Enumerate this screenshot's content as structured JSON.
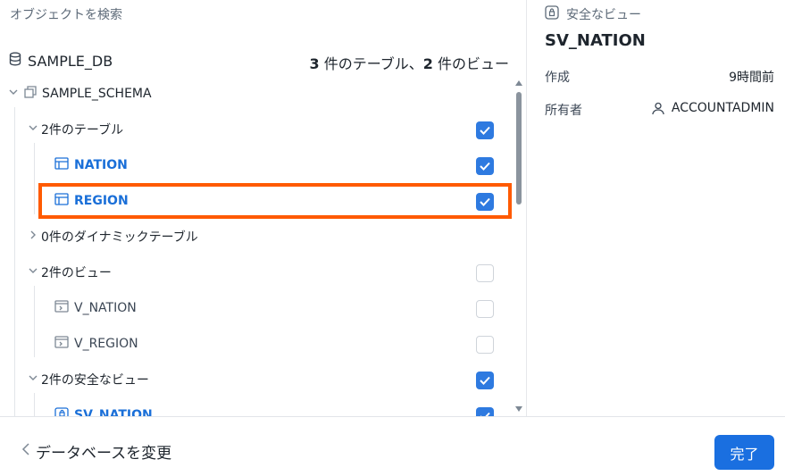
{
  "search": {
    "label": "オブジェクトを検索"
  },
  "database": {
    "name": "SAMPLE_DB",
    "table_count": "3",
    "view_count": "2",
    "summary_mid": " 件のテーブル、",
    "summary_end": " 件のビュー"
  },
  "schema": {
    "name": "SAMPLE_SCHEMA"
  },
  "groups": {
    "tables": {
      "label": "2件のテーブル"
    },
    "dynamic_tables": {
      "label": "0件のダイナミックテーブル"
    },
    "views": {
      "label": "2件のビュー"
    },
    "secure_views": {
      "label": "2件の安全なビュー"
    }
  },
  "items": {
    "nation": {
      "label": "NATION",
      "checked": true
    },
    "region": {
      "label": "REGION",
      "checked": true
    },
    "v_nation": {
      "label": "V_NATION",
      "checked": false
    },
    "v_region": {
      "label": "V_REGION",
      "checked": false
    },
    "sv_nation": {
      "label": "SV_NATION",
      "checked": true
    }
  },
  "detail": {
    "type_label": "安全なビュー",
    "title": "SV_NATION",
    "created_key": "作成",
    "created_value": "9時間前",
    "owner_key": "所有者",
    "owner_value": "ACCOUNTADMIN"
  },
  "footer": {
    "back_label": "データベースを変更",
    "done_label": "完了"
  },
  "colors": {
    "accent": "#2e7ae0",
    "highlight": "#ff5a00",
    "link": "#1a6fd8"
  },
  "icons": [
    "database-icon",
    "schema-icon",
    "table-icon",
    "view-icon",
    "secure-view-icon",
    "user-icon",
    "chevron-down-icon",
    "chevron-right-icon",
    "chevron-left-icon",
    "check-icon"
  ]
}
